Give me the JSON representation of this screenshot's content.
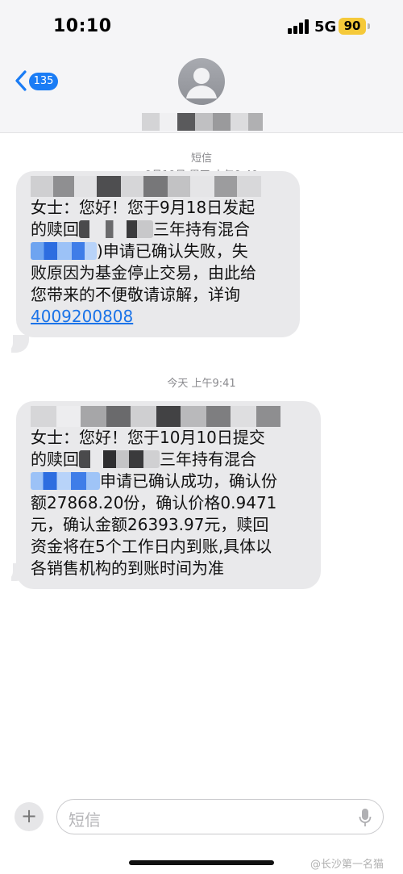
{
  "status_bar": {
    "time": "10:10",
    "network": "5G",
    "battery": "90",
    "battery_color": "#f5c93a"
  },
  "header": {
    "back_badge": "135",
    "back_icon": "chevron-left-icon",
    "avatar_icon": "person-icon",
    "accent_color": "#1a7cf5"
  },
  "thread": {
    "service": "短信",
    "date1": "9月19日 周四 上午9:40",
    "date2": "今天 上午9:41"
  },
  "message1": {
    "l1": "女士：您好！您于9月18日发起",
    "l2a": "的赎回",
    "l2b": "三年持有混合",
    "l3b": ")申请已确认失败，失",
    "l4": "败原因为基金停止交易，由此给",
    "l5": "您带来的不便敬请谅解，详询",
    "phone": "4009200808"
  },
  "message2": {
    "l1": "女士：您好！您于10月10日提交",
    "l2a": "的赎回",
    "l2b": "三年持有混合",
    "l3b": "申请已确认成功，确认份",
    "l4": "额27868.20份，确认价格0.9471",
    "l5": "元，确认金额26393.97元，赎回",
    "l6": "资金将在5个工作日内到账,具体以",
    "l7": "各销售机构的到账时间为准"
  },
  "composer": {
    "placeholder": "短信",
    "plus": "+",
    "mic_icon": "microphone-icon"
  },
  "watermark": "@长沙第一名猫"
}
